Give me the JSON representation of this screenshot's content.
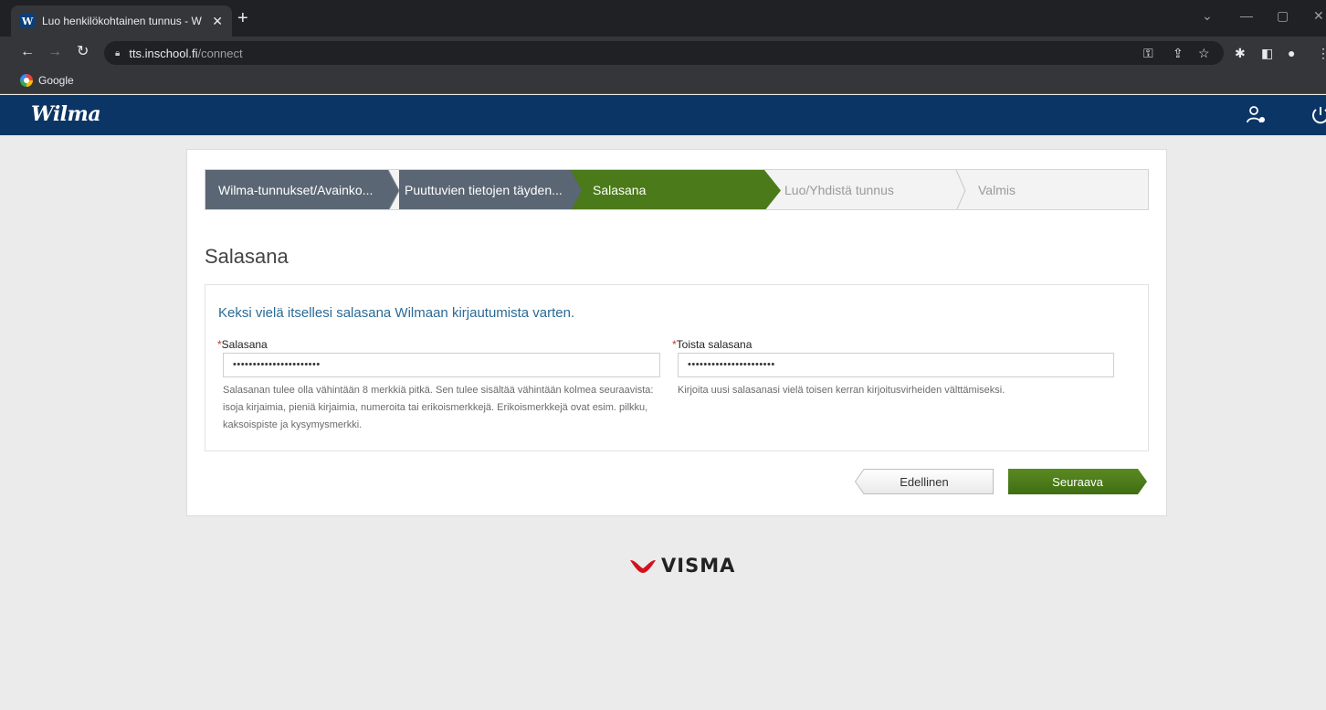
{
  "browser": {
    "tab_title": "Luo henkilökohtainen tunnus - W",
    "tab_favicon": "W",
    "new_tab": "+",
    "url_domain": "tts.inschool.fi",
    "url_path": "/connect",
    "bookmark": "Google"
  },
  "wilma": {
    "logo": "Wilma"
  },
  "steps": [
    {
      "label": "Wilma-tunnukset/Avainko..."
    },
    {
      "label": "Puuttuvien tietojen täyden..."
    },
    {
      "label": "Salasana"
    },
    {
      "label": "Luo/Yhdistä tunnus"
    },
    {
      "label": "Valmis"
    }
  ],
  "page": {
    "title": "Salasana",
    "intro": "Keksi vielä itsellesi salasana Wilmaan kirjautumista varten.",
    "required_mark": "*",
    "password": {
      "label": "Salasana",
      "value": "••••••••••••••••••••••",
      "help": "Salasanan tulee olla vähintään 8 merkkiä pitkä. Sen tulee sisältää vähintään kolmea seuraavista: isoja kirjaimia, pieniä kirjaimia, numeroita tai erikoismerkkejä. Erikoismerkkejä ovat esim. pilkku, kaksoispiste ja kysymysmerkki."
    },
    "confirm": {
      "label": "Toista salasana",
      "value": "••••••••••••••••••••••",
      "help": "Kirjoita uusi salasanasi vielä toisen kerran kirjoitusvirheiden välttämiseksi."
    },
    "prev_button": "Edellinen",
    "next_button": "Seuraava"
  },
  "footer": {
    "brand": "VISMA"
  },
  "colors": {
    "header": "#0b3565",
    "step_done": "#5a6673",
    "step_active": "#4a7a19",
    "intro_text": "#2a6a96",
    "next_button": "#4a7a19"
  }
}
